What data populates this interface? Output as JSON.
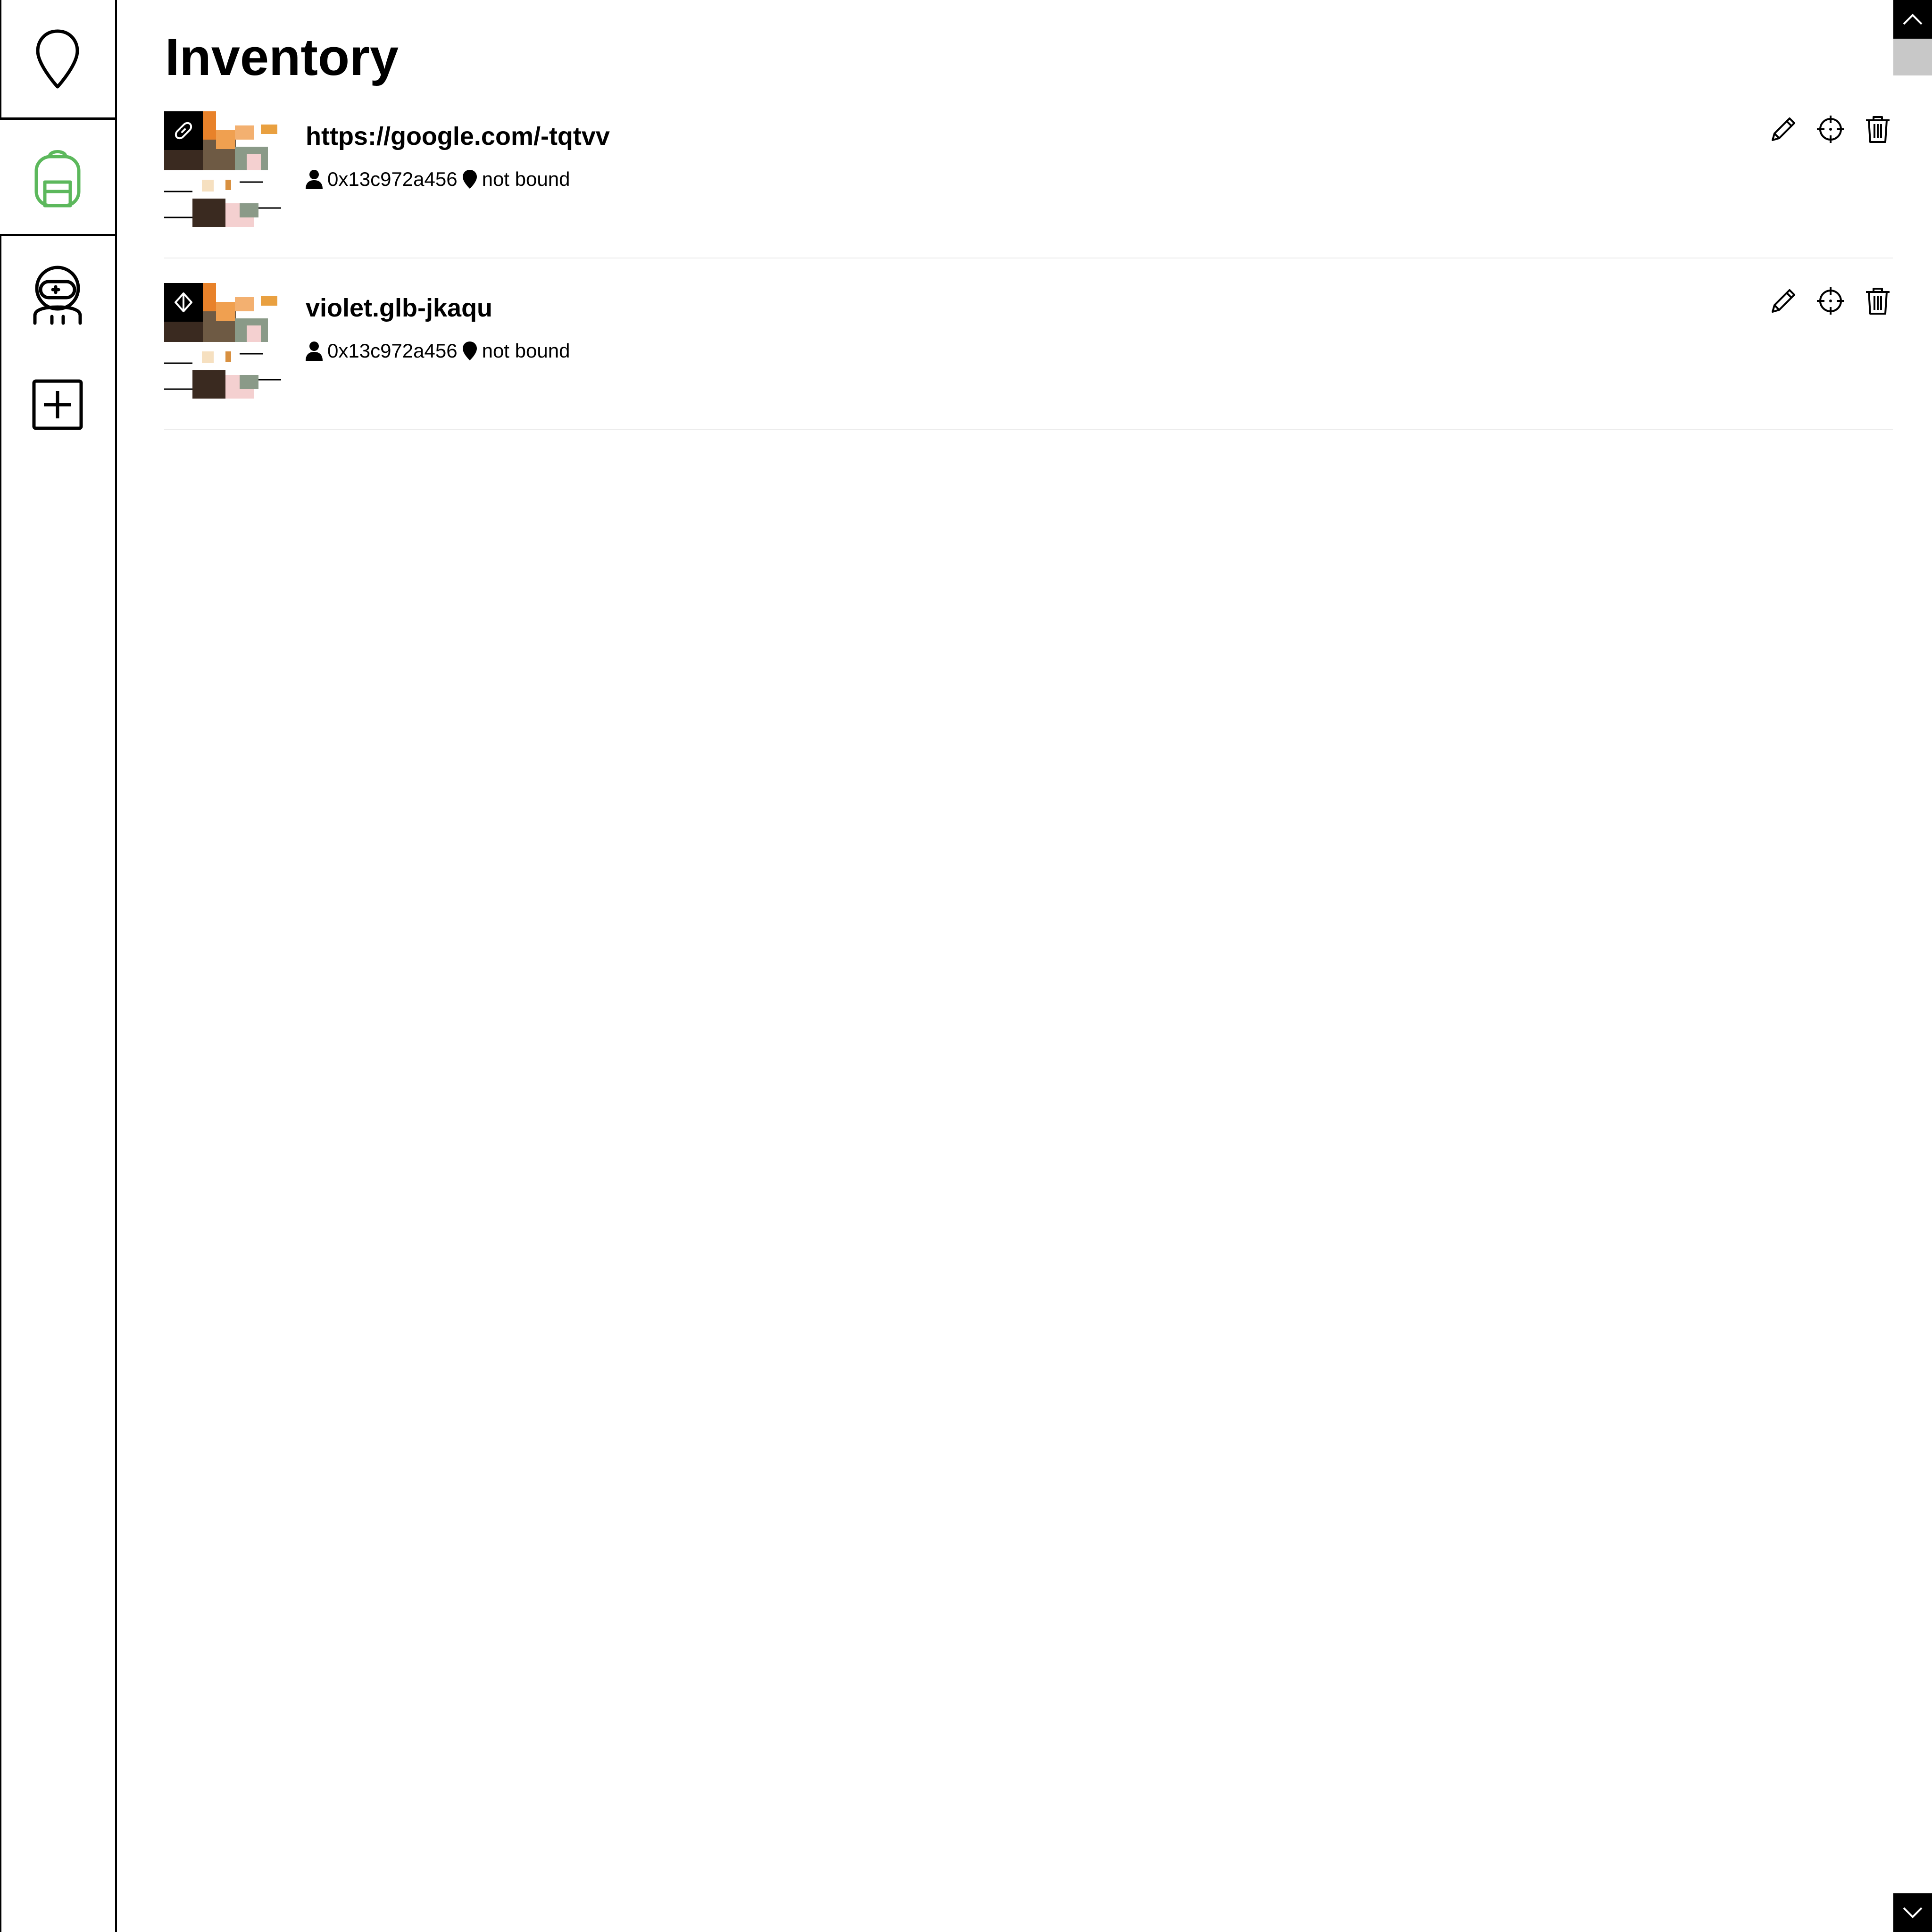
{
  "sidebar": {
    "tabs": [
      {
        "icon": "map-pin-icon",
        "active": false
      },
      {
        "icon": "backpack-icon",
        "active": true,
        "color": "#5cb85c"
      },
      {
        "icon": "astronaut-icon",
        "active": false
      },
      {
        "icon": "add-square-icon",
        "active": false
      }
    ]
  },
  "page": {
    "title": "Inventory"
  },
  "items": [
    {
      "name": "https://google.com/-tqtvv",
      "badge_icon": "link-icon",
      "owner": "0x13c972a456",
      "location": "not bound"
    },
    {
      "name": "violet.glb-jkaqu",
      "badge_icon": "3d-model-icon",
      "owner": "0x13c972a456",
      "location": "not bound"
    }
  ],
  "item_actions": [
    "edit-icon",
    "locate-icon",
    "delete-icon"
  ]
}
